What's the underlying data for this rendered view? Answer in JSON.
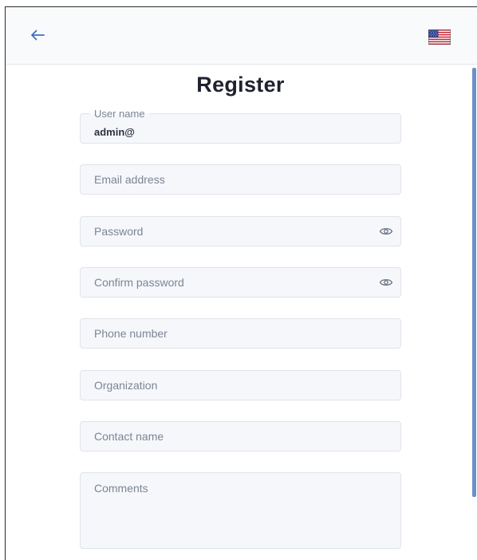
{
  "header": {
    "back_icon": "arrow-left-icon",
    "language_icon": "us-flag-icon",
    "accent_color": "#3f6fc4"
  },
  "page": {
    "title": "Register"
  },
  "form": {
    "username": {
      "label": "User name",
      "value": "admin@"
    },
    "email": {
      "placeholder": "Email address"
    },
    "password": {
      "placeholder": "Password",
      "toggle_icon": "eye-icon"
    },
    "confirm_password": {
      "placeholder": "Confirm password",
      "toggle_icon": "eye-icon"
    },
    "phone": {
      "placeholder": "Phone number"
    },
    "organization": {
      "placeholder": "Organization"
    },
    "contact_name": {
      "placeholder": "Contact name"
    },
    "comments": {
      "placeholder": "Comments"
    }
  }
}
